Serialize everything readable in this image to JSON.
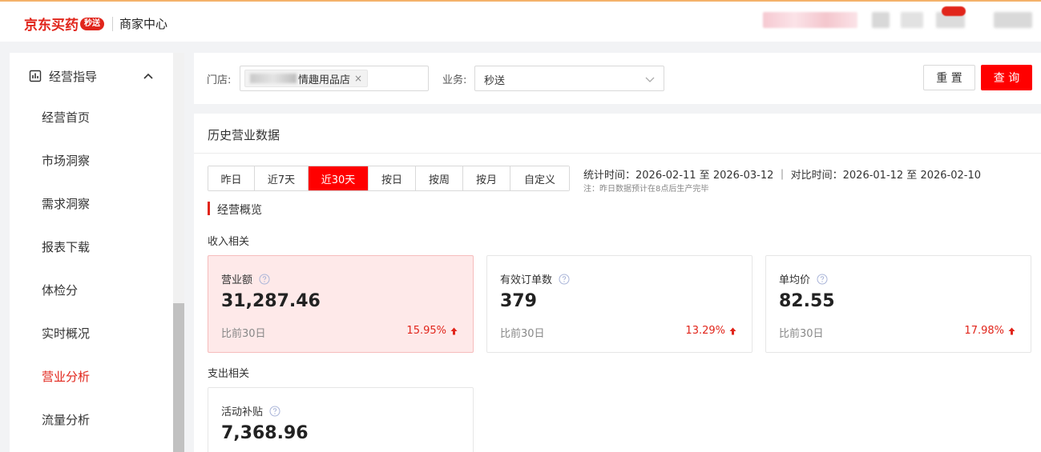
{
  "header": {
    "brand": "京东买药",
    "brand_badge": "秒送",
    "center_title": "商家中心"
  },
  "sidebar": {
    "section_label": "经营指导",
    "items": [
      {
        "label": "经营首页"
      },
      {
        "label": "市场洞察"
      },
      {
        "label": "需求洞察"
      },
      {
        "label": "报表下载"
      },
      {
        "label": "体检分"
      },
      {
        "label": "实时概况"
      },
      {
        "label": "营业分析",
        "active": true
      },
      {
        "label": "流量分析"
      }
    ]
  },
  "filter": {
    "store_label": "门店:",
    "store_tag": "情趣用品店",
    "store_tag_close": "×",
    "biz_label": "业务:",
    "biz_value": "秒送",
    "reset_label": "重 置",
    "query_label": "查 询"
  },
  "panel": {
    "title": "历史营业数据",
    "range_tabs": [
      {
        "label": "昨日"
      },
      {
        "label": "近7天"
      },
      {
        "label": "近30天",
        "active": true
      },
      {
        "label": "按日"
      },
      {
        "label": "按周"
      },
      {
        "label": "按月"
      },
      {
        "label": "自定义"
      }
    ],
    "stat_time": "统计时间：2026-02-11 至 2026-03-12  ｜  对比时间：2026-01-12 至 2026-02-10",
    "stat_note": "注：昨日数据预计在8点后生产完毕",
    "section_title": "经营概览",
    "income_label": "收入相关",
    "expense_label": "支出相关",
    "cards": [
      {
        "label": "营业额",
        "value": "31,287.46",
        "compare": "比前30日",
        "rate": "15.95%"
      },
      {
        "label": "有效订单数",
        "value": "379",
        "compare": "比前30日",
        "rate": "13.29%"
      },
      {
        "label": "单均价",
        "value": "82.55",
        "compare": "比前30日",
        "rate": "17.98%"
      }
    ],
    "expense_card": {
      "label": "活动补贴",
      "value": "7,368.96"
    }
  },
  "colors": {
    "brand_red": "#e1251b",
    "button_red": "#ff0000",
    "highlight_card_bg": "#fee9e9"
  }
}
